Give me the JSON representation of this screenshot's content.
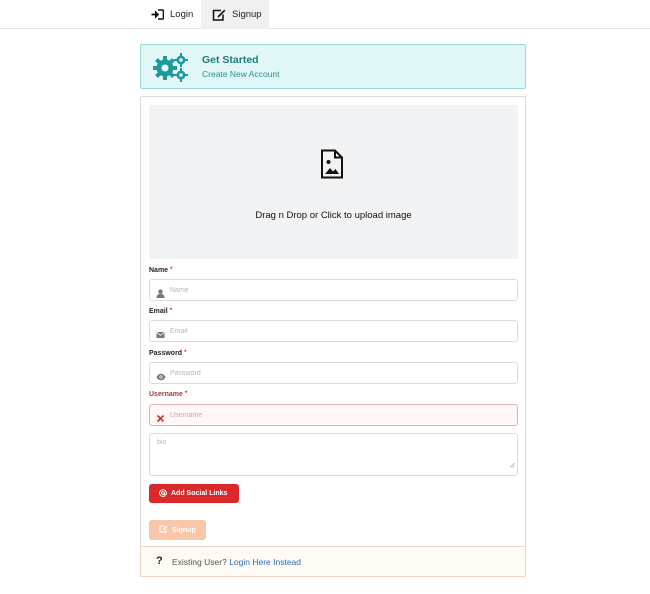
{
  "nav": {
    "login_label": "Login",
    "signup_label": "Signup",
    "active": "Signup"
  },
  "banner": {
    "title": "Get Started",
    "subtitle": "Create New Account",
    "icon": "gears-icon",
    "accent": "#1f7b7b"
  },
  "upload": {
    "text": "Drag n Drop or Click to upload image",
    "icon": "file-image-icon"
  },
  "form": {
    "name": {
      "label": "Name",
      "required_mark": "*",
      "placeholder": "Name",
      "value": "",
      "icon": "user-icon"
    },
    "email": {
      "label": "Email",
      "required_mark": "*",
      "placeholder": "Email",
      "value": "",
      "icon": "envelope-icon"
    },
    "password": {
      "label": "Password",
      "required_mark": "*",
      "placeholder": "Password",
      "value": "",
      "icon": "eye-icon"
    },
    "username": {
      "label": "Username",
      "required_mark": "*",
      "placeholder": "Username",
      "value": "",
      "icon": "close-icon",
      "state": "error"
    },
    "bio": {
      "placeholder": "bio",
      "value": ""
    },
    "social_button": {
      "label": "Add Social Links",
      "icon": "at-icon",
      "color": "#db2828"
    },
    "signup_button": {
      "label": "Signup",
      "icon": "edit-icon",
      "color": "#f8c6a9",
      "state": "disabled"
    }
  },
  "footer": {
    "icon": "?",
    "text": "Existing User?",
    "link": "Login Here Instead"
  }
}
